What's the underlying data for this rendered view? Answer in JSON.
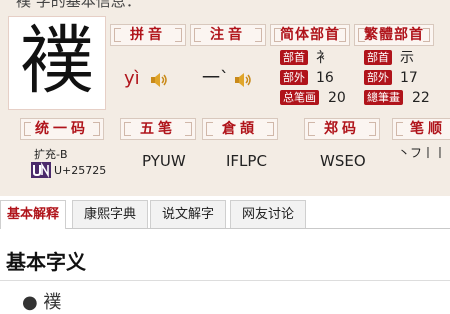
{
  "header": {
    "title": "襆 字的基本信息："
  },
  "character": {
    "glyph": "襆"
  },
  "sections": {
    "pinyin": {
      "label": "拼音",
      "value": "yì"
    },
    "zhuyin": {
      "label": "注音",
      "value": "一`"
    },
    "simplified": {
      "label": "简体部首",
      "radical_label": "部首",
      "radical": "衤",
      "outside_label": "部外",
      "outside": "16",
      "total_label": "总笔画",
      "total": "20"
    },
    "traditional": {
      "label": "繁體部首",
      "radical_label": "部首",
      "radical": "示",
      "outside_label": "部外",
      "outside": "17",
      "total_label": "總筆畫",
      "total": "22"
    },
    "unicode": {
      "label": "统一码",
      "block": "扩充-B",
      "code": "U+25725"
    },
    "wubi": {
      "label": "五笔",
      "value": "PYUW"
    },
    "cangjie": {
      "label": "倉頡",
      "value": "IFLPC"
    },
    "zhengma": {
      "label": "郑码",
      "value": "WSEO"
    },
    "bishun": {
      "label": "笔顺",
      "value": "丶フ丨丨"
    }
  },
  "tabs": [
    {
      "label": "基本解释"
    },
    {
      "label": "康熙字典"
    },
    {
      "label": "说文解字"
    },
    {
      "label": "网友讨论"
    }
  ],
  "content": {
    "heading": "基本字义",
    "entry": "● 襆"
  },
  "colors": {
    "accent": "#b0141b",
    "panel": "#f3ece4"
  }
}
